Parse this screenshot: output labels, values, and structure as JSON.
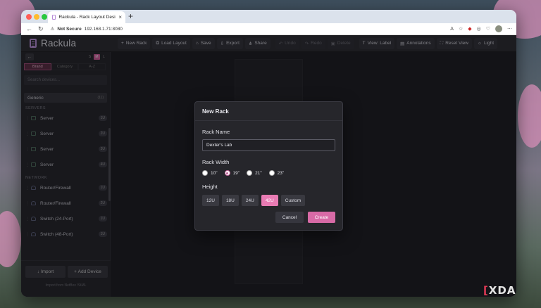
{
  "browser": {
    "tab_title": "Rackula - Rack Layout Designer",
    "tab_close": "×",
    "new_tab": "+",
    "security": "Not Secure",
    "url": "192.168.1.71:8080",
    "traffic_colors": [
      "#ff5f57",
      "#febc2e",
      "#28c840"
    ]
  },
  "app": {
    "name": "Rackula",
    "toolbar": [
      {
        "label": "New Rack",
        "icon": "+",
        "enabled": true
      },
      {
        "label": "Load Layout",
        "icon": "⧉",
        "enabled": true
      },
      {
        "label": "Save",
        "icon": "⌂",
        "enabled": true
      },
      {
        "label": "Export",
        "icon": "⇩",
        "enabled": true
      },
      {
        "label": "Share",
        "icon": "⋔",
        "enabled": true
      },
      {
        "label": "Undo",
        "icon": "↶",
        "enabled": false
      },
      {
        "label": "Redo",
        "icon": "↷",
        "enabled": false
      },
      {
        "label": "Delete",
        "icon": "▣",
        "enabled": false
      },
      {
        "label": "View: Label",
        "icon": "T",
        "enabled": true
      },
      {
        "label": "Annotations",
        "icon": "▤",
        "enabled": true
      },
      {
        "label": "Reset View",
        "icon": "⛶",
        "enabled": true
      },
      {
        "label": "Light",
        "icon": "☼",
        "enabled": true
      }
    ]
  },
  "sidebar": {
    "back_icon": "←",
    "sizes": [
      "S",
      "M",
      "L"
    ],
    "sizes_selected": "M",
    "sort_tabs": [
      "Brand",
      "Category",
      "A-Z"
    ],
    "sort_selected": "Brand",
    "search_placeholder": "Search devices...",
    "category": {
      "name": "Generic",
      "count": "(11)"
    },
    "groups": [
      {
        "name": "SERVERS",
        "devices": [
          {
            "name": "Server",
            "u": "1U"
          },
          {
            "name": "Server",
            "u": "2U"
          },
          {
            "name": "Server",
            "u": "3U"
          },
          {
            "name": "Server",
            "u": "4U"
          }
        ]
      },
      {
        "name": "NETWORK",
        "devices": [
          {
            "name": "Router/Firewall",
            "u": "1U"
          },
          {
            "name": "Router/Firewall",
            "u": "2U"
          },
          {
            "name": "Switch (24-Port)",
            "u": "1U"
          },
          {
            "name": "Switch (48-Port)",
            "u": "1U"
          }
        ]
      }
    ],
    "import_label": "Import",
    "add_device_label": "Add Device",
    "netbox_label": "Import from NetBox YAML"
  },
  "modal": {
    "title": "New Rack",
    "rack_name_label": "Rack Name",
    "rack_name_value": "Dexter's Lab",
    "rack_width_label": "Rack Width",
    "widths": [
      "10\"",
      "19\"",
      "21\"",
      "23\""
    ],
    "width_selected": "19\"",
    "height_label": "Height",
    "heights": [
      "12U",
      "18U",
      "24U",
      "42U",
      "Custom"
    ],
    "height_selected": "42U",
    "cancel_label": "Cancel",
    "create_label": "Create"
  },
  "watermark": {
    "bracket": "[",
    "text": "XDA"
  }
}
